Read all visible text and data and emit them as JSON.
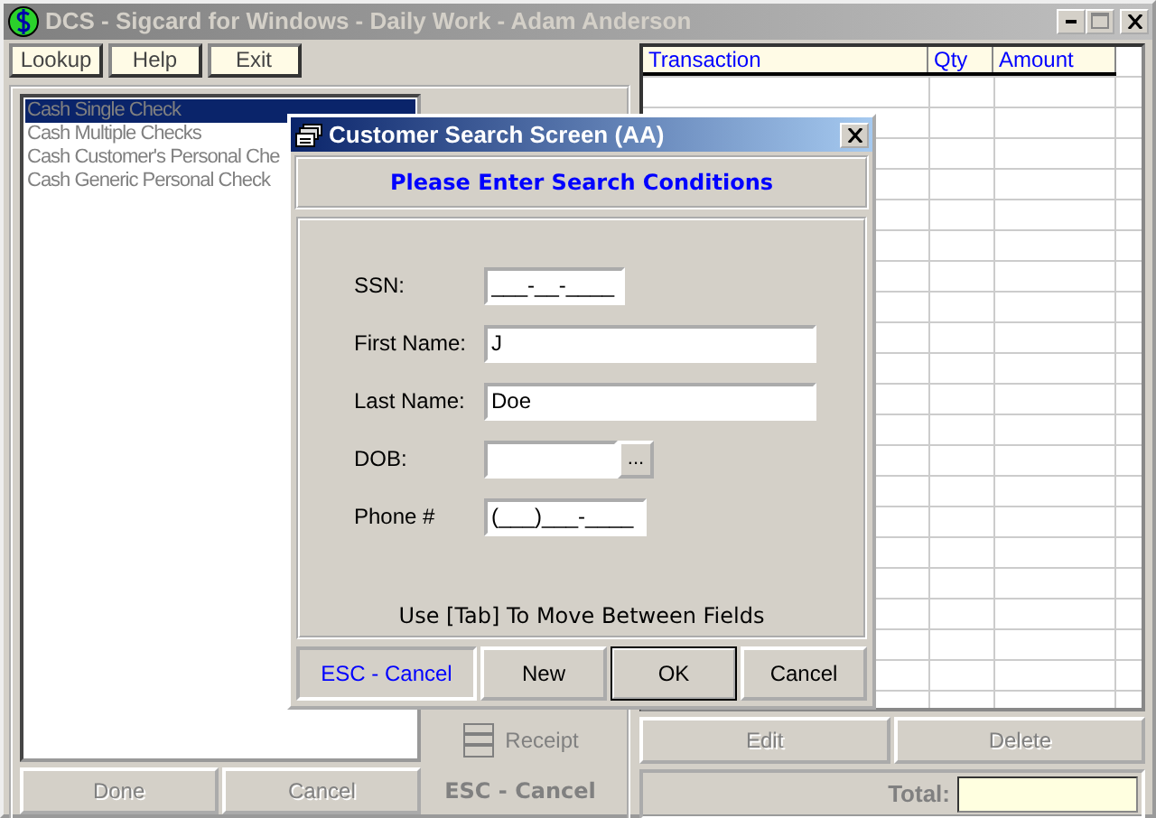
{
  "window": {
    "title": "DCS - Sigcard for Windows - Daily Work - Adam Anderson"
  },
  "menu": [
    {
      "label": "Lookup"
    },
    {
      "label": "Help"
    },
    {
      "label": "Exit"
    }
  ],
  "transactions_list": [
    {
      "label": "Cash Single Check",
      "selected": true
    },
    {
      "label": "Cash Multiple Checks",
      "selected": false
    },
    {
      "label": "Cash Customer's Personal Che",
      "selected": false
    },
    {
      "label": "Cash Generic Personal Check",
      "selected": false
    }
  ],
  "list_buttons": [
    {
      "label": "Done",
      "disabled": true
    },
    {
      "label": "Cancel",
      "disabled": true
    }
  ],
  "receipt_button": {
    "label": "Receipt"
  },
  "esc_hint": "ESC - Cancel",
  "table": {
    "columns": [
      "Transaction",
      "Qty",
      "Amount"
    ]
  },
  "table_buttons": [
    {
      "label": "Edit",
      "disabled": true
    },
    {
      "label": "Delete",
      "disabled": true
    }
  ],
  "total_label": "Total:",
  "dialog": {
    "title": "Customer Search Screen (AA)",
    "heading": "Please Enter Search Conditions",
    "fields": [
      {
        "label": "SSN:",
        "kind": "masked",
        "value": "___-__-____"
      },
      {
        "label": "First Name:",
        "kind": "text",
        "value": "J"
      },
      {
        "label": "Last Name:",
        "kind": "text",
        "value": "Doe"
      },
      {
        "label": "DOB:",
        "kind": "date",
        "button": "..."
      },
      {
        "label": "Phone #",
        "kind": "masked",
        "value": "(___)___-____"
      }
    ],
    "hint": "Use [Tab] To Move Between Fields",
    "esc_hint": "ESC - Cancel",
    "buttons": [
      {
        "label": "New",
        "default": false
      },
      {
        "label": "OK",
        "default": true
      },
      {
        "label": "Cancel",
        "default": false
      }
    ]
  }
}
